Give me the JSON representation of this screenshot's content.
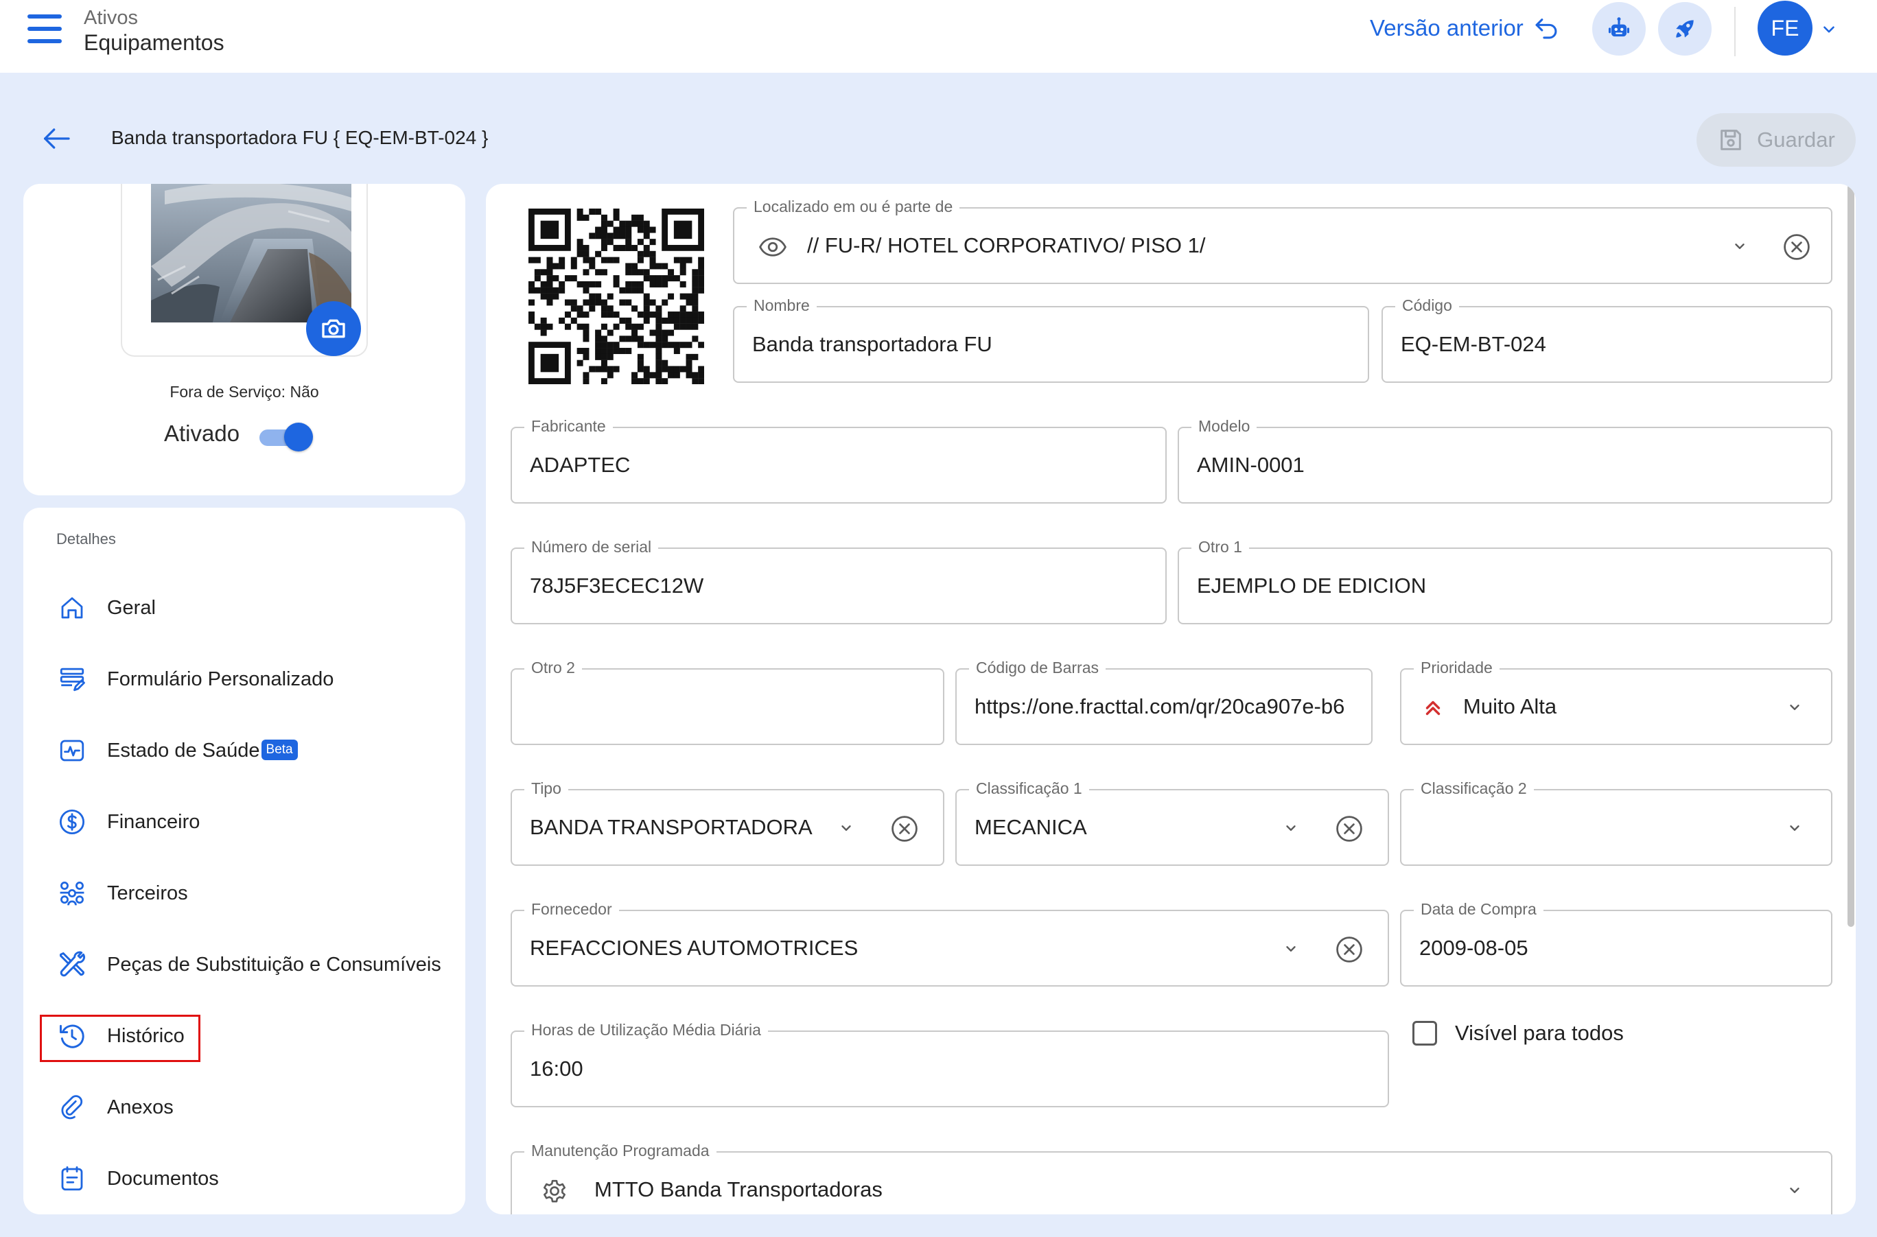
{
  "header": {
    "module": "Ativos",
    "section": "Equipamentos",
    "previous_version": "Versão anterior",
    "user_initials": "FE"
  },
  "page": {
    "title": "Banda transportadora FU { EQ-EM-BT-024 }",
    "save_label": "Guardar"
  },
  "asset_card": {
    "out_of_service": "Fora de Serviço: Não",
    "enabled_label": "Ativado",
    "enabled": true
  },
  "menu": {
    "heading": "Detalhes",
    "items": [
      {
        "label": "Geral",
        "icon": "home-icon"
      },
      {
        "label": "Formulário Personalizado",
        "icon": "form-icon"
      },
      {
        "label": "Estado de Saúde",
        "icon": "health-icon",
        "badge": "Beta"
      },
      {
        "label": "Financeiro",
        "icon": "dollar-icon"
      },
      {
        "label": "Terceiros",
        "icon": "people-icon"
      },
      {
        "label": "Peças de Substituição e Consumíveis",
        "icon": "tools-icon"
      },
      {
        "label": "Histórico",
        "icon": "history-icon"
      },
      {
        "label": "Anexos",
        "icon": "attachment-icon"
      },
      {
        "label": "Documentos",
        "icon": "document-icon"
      }
    ]
  },
  "form": {
    "location": {
      "label": "Localizado em ou é parte de",
      "value": "// FU-R/ HOTEL CORPORATIVO/ PISO 1/"
    },
    "name": {
      "label": "Nombre",
      "value": "Banda transportadora FU"
    },
    "code": {
      "label": "Código",
      "value": "EQ-EM-BT-024"
    },
    "manufacturer": {
      "label": "Fabricante",
      "value": "ADAPTEC"
    },
    "model": {
      "label": "Modelo",
      "value": "AMIN-0001"
    },
    "serial": {
      "label": "Número de serial",
      "value": "78J5F3ECEC12W"
    },
    "other1": {
      "label": "Otro 1",
      "value": "EJEMPLO DE EDICION"
    },
    "other2": {
      "label": "Otro 2",
      "value": ""
    },
    "barcode": {
      "label": "Código de Barras",
      "value": "https://one.fracttal.com/qr/20ca907e-b6"
    },
    "priority": {
      "label": "Prioridade",
      "value": "Muito Alta"
    },
    "type": {
      "label": "Tipo",
      "value": "BANDA TRANSPORTADORA"
    },
    "class1": {
      "label": "Classificação 1",
      "value": "MECANICA"
    },
    "class2": {
      "label": "Classificação 2",
      "value": ""
    },
    "supplier": {
      "label": "Fornecedor",
      "value": "REFACCIONES AUTOMOTRICES"
    },
    "purchase_date": {
      "label": "Data de Compra",
      "value": "2009-08-05"
    },
    "avg_hours": {
      "label": "Horas de Utilização Média Diária",
      "value": "16:00"
    },
    "visible_all": {
      "label": "Visível para todos",
      "checked": false
    },
    "scheduled_maintenance": {
      "label": "Manutenção Programada",
      "value": "MTTO Banda Transportadoras"
    }
  },
  "colors": {
    "primary": "#1e66e0",
    "background": "#e4ecfb",
    "priority_high": "#d32f2f",
    "highlight_box": "#e01010"
  }
}
